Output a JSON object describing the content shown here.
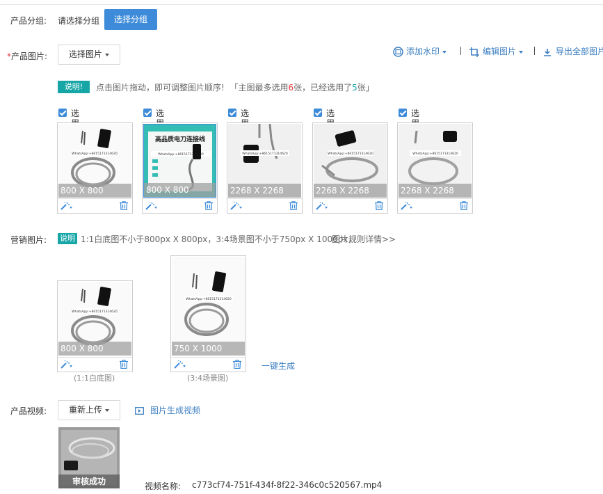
{
  "group": {
    "label": "产品分组:",
    "placeholder": "请选择分组",
    "button": "选择分组"
  },
  "product_images": {
    "required_mark": "*",
    "label": "产品图片:",
    "select_button": "选择图片",
    "tools": {
      "watermark": "添加水印",
      "edit": "编辑图片",
      "export": "导出全部图片"
    },
    "notice_badge": "说明!",
    "notice_text": "点击图片拖动，即可调整图片顺序!",
    "notice_bracket_start": "「主图最多选用",
    "notice_max": "6",
    "notice_middle": "张，已经选用了",
    "notice_used": "5",
    "notice_end": "张」",
    "items": [
      {
        "checkbox_label": "选用",
        "dimensions": "800 X 800",
        "overlay_text": "WhatsApp:+8615171314620"
      },
      {
        "checkbox_label": "选用",
        "dimensions": "800 X 800",
        "overlay_title": "高品质电刀连接线",
        "overlay_text": "WhatsApp:+8615171314620"
      },
      {
        "checkbox_label": "选用",
        "dimensions": "2268 X 2268",
        "overlay_text": "WhatsApp:+8615171314620"
      },
      {
        "checkbox_label": "选用",
        "dimensions": "2268 X 2268",
        "overlay_text": "WhatsApp:+8615171314620"
      },
      {
        "checkbox_label": "选用",
        "dimensions": "2268 X 2268",
        "overlay_text": "WhatsApp:+8615171314620"
      }
    ]
  },
  "marketing_images": {
    "label": "营销图片:",
    "badge": "说明",
    "text": "1:1白底图不小于800px X 800px，3:4场景图不小于750px X 1000px，",
    "rules_link": "图片规则详情>>",
    "items": [
      {
        "dimensions": "800 X 800",
        "caption": "(1:1白底图)",
        "overlay_text": "WhatsApp:+8615171314620"
      },
      {
        "dimensions": "750 X 1000",
        "caption": "(3:4场景图)",
        "overlay_text": "WhatsApp:+8615171314620"
      }
    ],
    "generate_link": "一键生成"
  },
  "video": {
    "label": "产品视频:",
    "reupload_button": "重新上传",
    "generate_link": "图片生成视频",
    "status": "审核成功",
    "name_label": "视频名称:",
    "filename": "c773cf74-751f-434f-8f22-346c0c520567.mp4"
  },
  "colors": {
    "accent": "#3d8bd9",
    "link": "#3d7fc1",
    "teal": "#16a6a6",
    "red": "#e4393c"
  }
}
